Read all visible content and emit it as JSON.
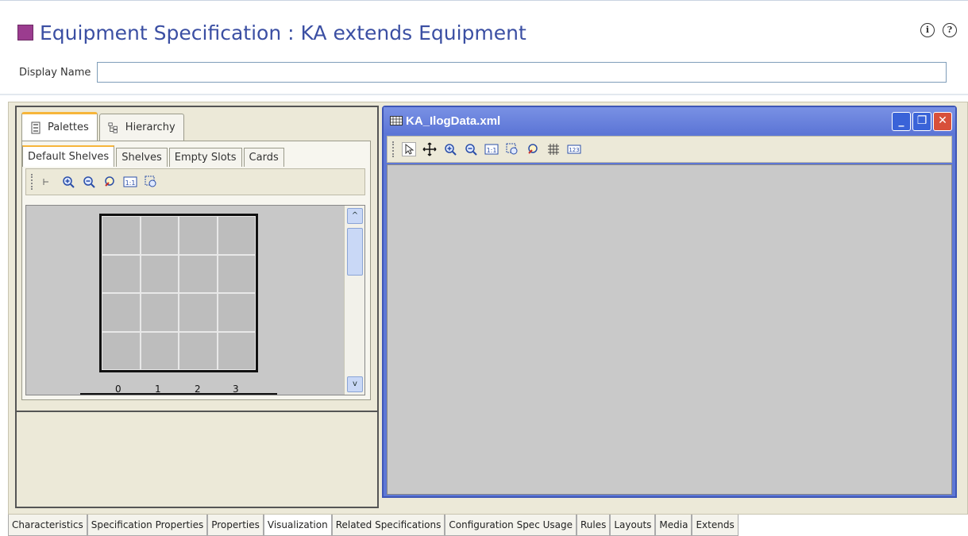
{
  "header": {
    "title": "Equipment Specification : KA extends Equipment",
    "title_color": "#3b4fa3",
    "swatch_color": "#9b3c8f",
    "info_icon": "info-icon",
    "help_icon": "help-icon",
    "info_glyph": "i",
    "help_glyph": "?"
  },
  "display_name": {
    "label": "Display Name",
    "value": ""
  },
  "palette": {
    "tabs": [
      {
        "label": "Palettes",
        "icon": "palette-icon",
        "active": true
      },
      {
        "label": "Hierarchy",
        "icon": "hierarchy-icon",
        "active": false
      }
    ],
    "sub_tabs": [
      {
        "label": "Default Shelves",
        "active": true
      },
      {
        "label": "Shelves",
        "active": false
      },
      {
        "label": "Empty Slots",
        "active": false
      },
      {
        "label": "Cards",
        "active": false
      }
    ],
    "toolbar_icons": [
      "select-icon",
      "zoom-in-icon",
      "zoom-out-icon",
      "zoom-fit-icon",
      "actual-size-icon",
      "zoom-region-icon"
    ],
    "ruler_labels": [
      "0",
      "1",
      "2",
      "3"
    ],
    "scroll_up": "^",
    "scroll_down": "v"
  },
  "xml_window": {
    "title": "KA_IlogData.xml",
    "buttons": {
      "minimize": "_",
      "restore": "❐",
      "close": "✕"
    },
    "toolbar_icons": [
      "pointer-icon",
      "pan-icon",
      "zoom-in-icon",
      "zoom-out-icon",
      "actual-size-icon",
      "zoom-region-icon",
      "zoom-fit-icon",
      "grid-icon",
      "numbering-icon"
    ]
  },
  "bottom_tabs": [
    {
      "label": "Characteristics",
      "active": false
    },
    {
      "label": "Specification Properties",
      "active": false
    },
    {
      "label": "Properties",
      "active": false
    },
    {
      "label": "Visualization",
      "active": true
    },
    {
      "label": "Related Specifications",
      "active": false
    },
    {
      "label": "Configuration Spec Usage",
      "active": false
    },
    {
      "label": "Rules",
      "active": false
    },
    {
      "label": "Layouts",
      "active": false
    },
    {
      "label": "Media",
      "active": false
    },
    {
      "label": "Extends",
      "active": false
    }
  ]
}
